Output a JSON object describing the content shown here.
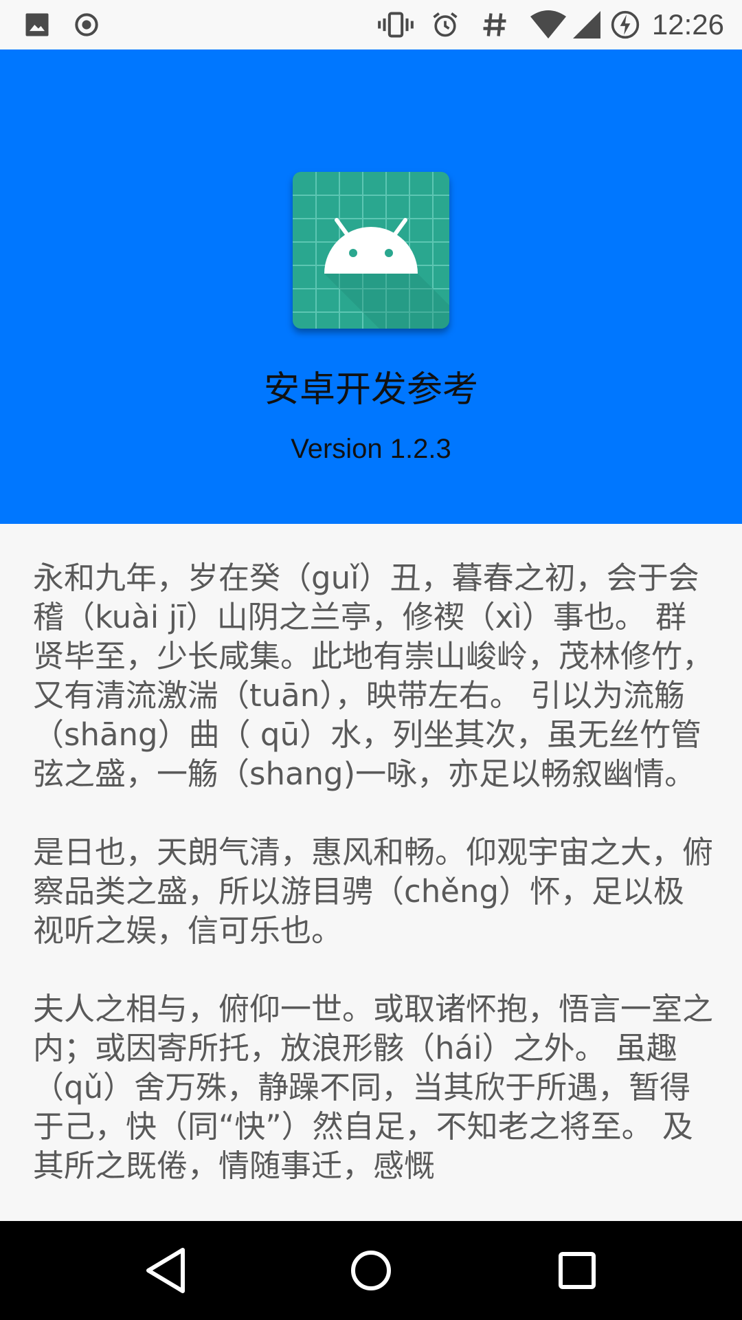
{
  "status_bar": {
    "time": "12:26",
    "left_icons": [
      "image-icon",
      "radio-record-icon"
    ],
    "right_icons": [
      "vibrate-icon",
      "alarm-icon",
      "hash-icon",
      "wifi-icon",
      "signal-icon",
      "battery-charging-icon"
    ]
  },
  "header": {
    "background_color": "#0077ff",
    "app_name": "安卓开发参考",
    "version": "Version 1.2.3",
    "icon": "android-app-icon"
  },
  "content": {
    "paragraphs": [
      " 永和九年，岁在癸（guǐ）丑，暮春之初，会于会稽（kuài jī）山阴之兰亭，修禊（xì）事也。 群贤毕至，少长咸集。此地有崇山峻岭，茂林修竹， 又有清流激湍（tuān），映带左右。 引以为流觞（shāng）曲（ qū）水，列坐其次，虽无丝竹管弦之盛，一觞（shang)一咏，亦足以畅叙幽情。",
      " 是日也，天朗气清，惠风和畅。仰观宇宙之大，俯察品类之盛，所以游目骋（chěng）怀，足以极视听之娱，信可乐也。",
      " 夫人之相与，俯仰一世。或取诸怀抱，悟言一室之内；或因寄所托，放浪形骸（hái）之外。 虽趣（qǔ）舍万殊，静躁不同，当其欣于所遇，暂得于己，快（同“快”）然自足，不知老之将至。 及其所之既倦，情随事迁，感慨"
    ]
  },
  "nav_bar": {
    "back_icon": "back-triangle-icon",
    "home_icon": "home-circle-icon",
    "recents_icon": "recents-square-icon"
  }
}
